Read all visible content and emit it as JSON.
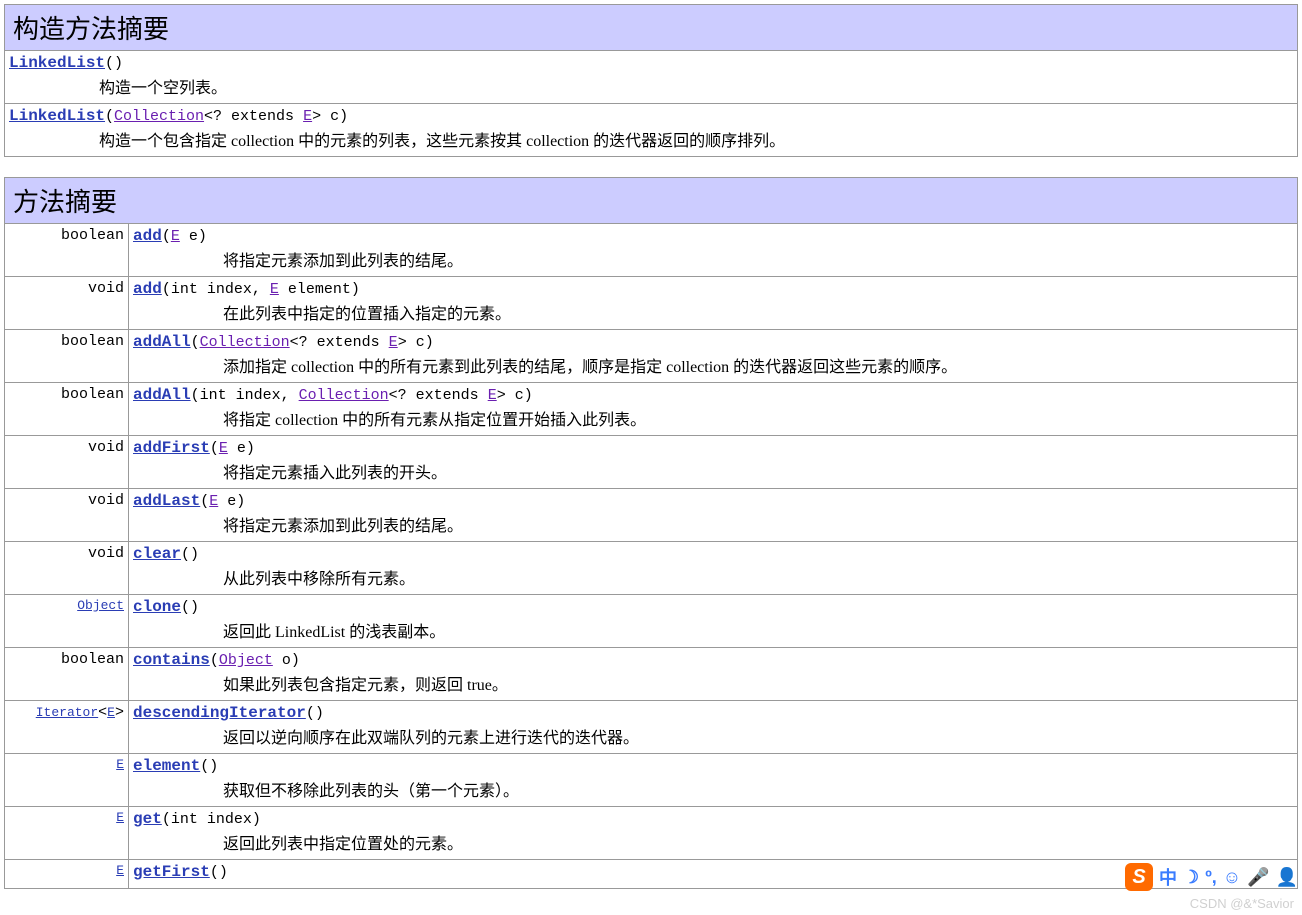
{
  "constructor_summary": {
    "title": "构造方法摘要",
    "rows": [
      {
        "sig_parts": [
          {
            "t": "link",
            "v": "LinkedList"
          },
          {
            "t": "mono",
            "v": "()"
          }
        ],
        "desc": "构造一个空列表。"
      },
      {
        "sig_parts": [
          {
            "t": "link",
            "v": "LinkedList"
          },
          {
            "t": "mono",
            "v": "("
          },
          {
            "t": "typelink",
            "v": "Collection"
          },
          {
            "t": "mono",
            "v": "<? extends "
          },
          {
            "t": "typelink",
            "v": "E"
          },
          {
            "t": "mono",
            "v": "> c)"
          }
        ],
        "desc": "构造一个包含指定 collection 中的元素的列表，这些元素按其 collection 的迭代器返回的顺序排列。"
      }
    ]
  },
  "method_summary": {
    "title": "方法摘要",
    "rows": [
      {
        "ret": [
          {
            "t": "text",
            "v": "boolean"
          }
        ],
        "sig_parts": [
          {
            "t": "link",
            "v": "add"
          },
          {
            "t": "mono",
            "v": "("
          },
          {
            "t": "typelink",
            "v": "E"
          },
          {
            "t": "mono",
            "v": " e)"
          }
        ],
        "desc": "将指定元素添加到此列表的结尾。"
      },
      {
        "ret": [
          {
            "t": "text",
            "v": "void"
          }
        ],
        "sig_parts": [
          {
            "t": "link",
            "v": "add"
          },
          {
            "t": "mono",
            "v": "(int index, "
          },
          {
            "t": "typelink",
            "v": "E"
          },
          {
            "t": "mono",
            "v": " element)"
          }
        ],
        "desc": "在此列表中指定的位置插入指定的元素。"
      },
      {
        "ret": [
          {
            "t": "text",
            "v": "boolean"
          }
        ],
        "sig_parts": [
          {
            "t": "link",
            "v": "addAll"
          },
          {
            "t": "mono",
            "v": "("
          },
          {
            "t": "typelink",
            "v": "Collection"
          },
          {
            "t": "mono",
            "v": "<? extends "
          },
          {
            "t": "typelink",
            "v": "E"
          },
          {
            "t": "mono",
            "v": "> c)"
          }
        ],
        "desc": "添加指定 collection 中的所有元素到此列表的结尾，顺序是指定 collection 的迭代器返回这些元素的顺序。"
      },
      {
        "ret": [
          {
            "t": "text",
            "v": "boolean"
          }
        ],
        "sig_parts": [
          {
            "t": "link",
            "v": "addAll"
          },
          {
            "t": "mono",
            "v": "(int index, "
          },
          {
            "t": "typelink",
            "v": "Collection"
          },
          {
            "t": "mono",
            "v": "<? extends "
          },
          {
            "t": "typelink",
            "v": "E"
          },
          {
            "t": "mono",
            "v": "> c)"
          }
        ],
        "desc": "将指定 collection 中的所有元素从指定位置开始插入此列表。"
      },
      {
        "ret": [
          {
            "t": "text",
            "v": "void"
          }
        ],
        "sig_parts": [
          {
            "t": "link",
            "v": "addFirst"
          },
          {
            "t": "mono",
            "v": "("
          },
          {
            "t": "typelink",
            "v": "E"
          },
          {
            "t": "mono",
            "v": " e)"
          }
        ],
        "desc": "将指定元素插入此列表的开头。"
      },
      {
        "ret": [
          {
            "t": "text",
            "v": "void"
          }
        ],
        "sig_parts": [
          {
            "t": "link",
            "v": "addLast"
          },
          {
            "t": "mono",
            "v": "("
          },
          {
            "t": "typelink",
            "v": "E"
          },
          {
            "t": "mono",
            "v": " e)"
          }
        ],
        "desc": "将指定元素添加到此列表的结尾。"
      },
      {
        "ret": [
          {
            "t": "text",
            "v": "void"
          }
        ],
        "sig_parts": [
          {
            "t": "link",
            "v": "clear"
          },
          {
            "t": "mono",
            "v": "()"
          }
        ],
        "desc": "从此列表中移除所有元素。"
      },
      {
        "ret": [
          {
            "t": "retlink",
            "v": "Object"
          }
        ],
        "sig_parts": [
          {
            "t": "link",
            "v": "clone"
          },
          {
            "t": "mono",
            "v": "()"
          }
        ],
        "desc": "返回此 LinkedList 的浅表副本。"
      },
      {
        "ret": [
          {
            "t": "text",
            "v": "boolean"
          }
        ],
        "sig_parts": [
          {
            "t": "link",
            "v": "contains"
          },
          {
            "t": "mono",
            "v": "("
          },
          {
            "t": "typelink",
            "v": "Object"
          },
          {
            "t": "mono",
            "v": " o)"
          }
        ],
        "desc": "如果此列表包含指定元素，则返回 true。"
      },
      {
        "ret": [
          {
            "t": "retlink",
            "v": "Iterator"
          },
          {
            "t": "text",
            "v": "<"
          },
          {
            "t": "retlink",
            "v": "E"
          },
          {
            "t": "text",
            "v": ">"
          }
        ],
        "sig_parts": [
          {
            "t": "link",
            "v": "descendingIterator"
          },
          {
            "t": "mono",
            "v": "()"
          }
        ],
        "desc": "返回以逆向顺序在此双端队列的元素上进行迭代的迭代器。"
      },
      {
        "ret": [
          {
            "t": "retlink",
            "v": "E"
          }
        ],
        "sig_parts": [
          {
            "t": "link",
            "v": "element"
          },
          {
            "t": "mono",
            "v": "()"
          }
        ],
        "desc": "获取但不移除此列表的头（第一个元素）。"
      },
      {
        "ret": [
          {
            "t": "retlink",
            "v": "E"
          }
        ],
        "sig_parts": [
          {
            "t": "link",
            "v": "get"
          },
          {
            "t": "mono",
            "v": "(int index)"
          }
        ],
        "desc": "返回此列表中指定位置处的元素。"
      },
      {
        "ret": [
          {
            "t": "retlink",
            "v": "E"
          }
        ],
        "sig_parts": [
          {
            "t": "link",
            "v": "getFirst"
          },
          {
            "t": "mono",
            "v": "()"
          }
        ],
        "desc": ""
      }
    ]
  },
  "ime": {
    "logo": "S",
    "items": [
      "中",
      "☽",
      "º,",
      "☺",
      "🎤",
      "👤"
    ]
  },
  "watermark": "CSDN @&*Savior"
}
